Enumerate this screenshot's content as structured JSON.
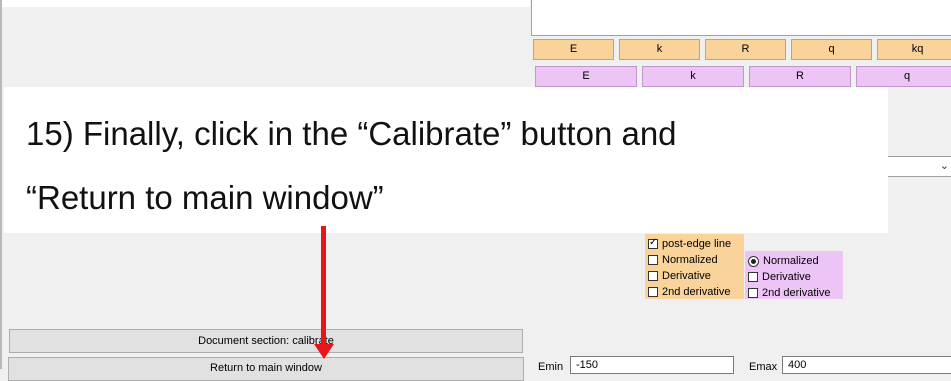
{
  "top_row_buttons": [
    "E",
    "k",
    "R",
    "q",
    "kq"
  ],
  "second_row_buttons": [
    "E",
    "k",
    "R",
    "q"
  ],
  "instruction": {
    "line1": "15) Finally, click in the “Calibrate” button and",
    "line2": "“Return to main window”"
  },
  "left_plot_options": [
    {
      "label": "post-edge line",
      "checked": true
    },
    {
      "label": "Normalized",
      "checked": false
    },
    {
      "label": "Derivative",
      "checked": false
    },
    {
      "label": "2nd derivative",
      "checked": false
    }
  ],
  "right_plot_options": [
    {
      "label": "Normalized",
      "type": "radio",
      "selected": true
    },
    {
      "label": "Derivative",
      "type": "checkbox",
      "checked": false
    },
    {
      "label": "2nd derivative",
      "type": "checkbox",
      "checked": false
    }
  ],
  "buttons": {
    "document_section": "Document section: calibrate",
    "return_to_main": "Return to main window"
  },
  "range": {
    "emin_label": "Emin",
    "emin_value": "-150",
    "emax_label": "Emax",
    "emax_value": "400"
  },
  "colors": {
    "orange_buttons": "#f9d39a",
    "purple_buttons": "#edc4f6",
    "arrow": "#e8151b"
  }
}
